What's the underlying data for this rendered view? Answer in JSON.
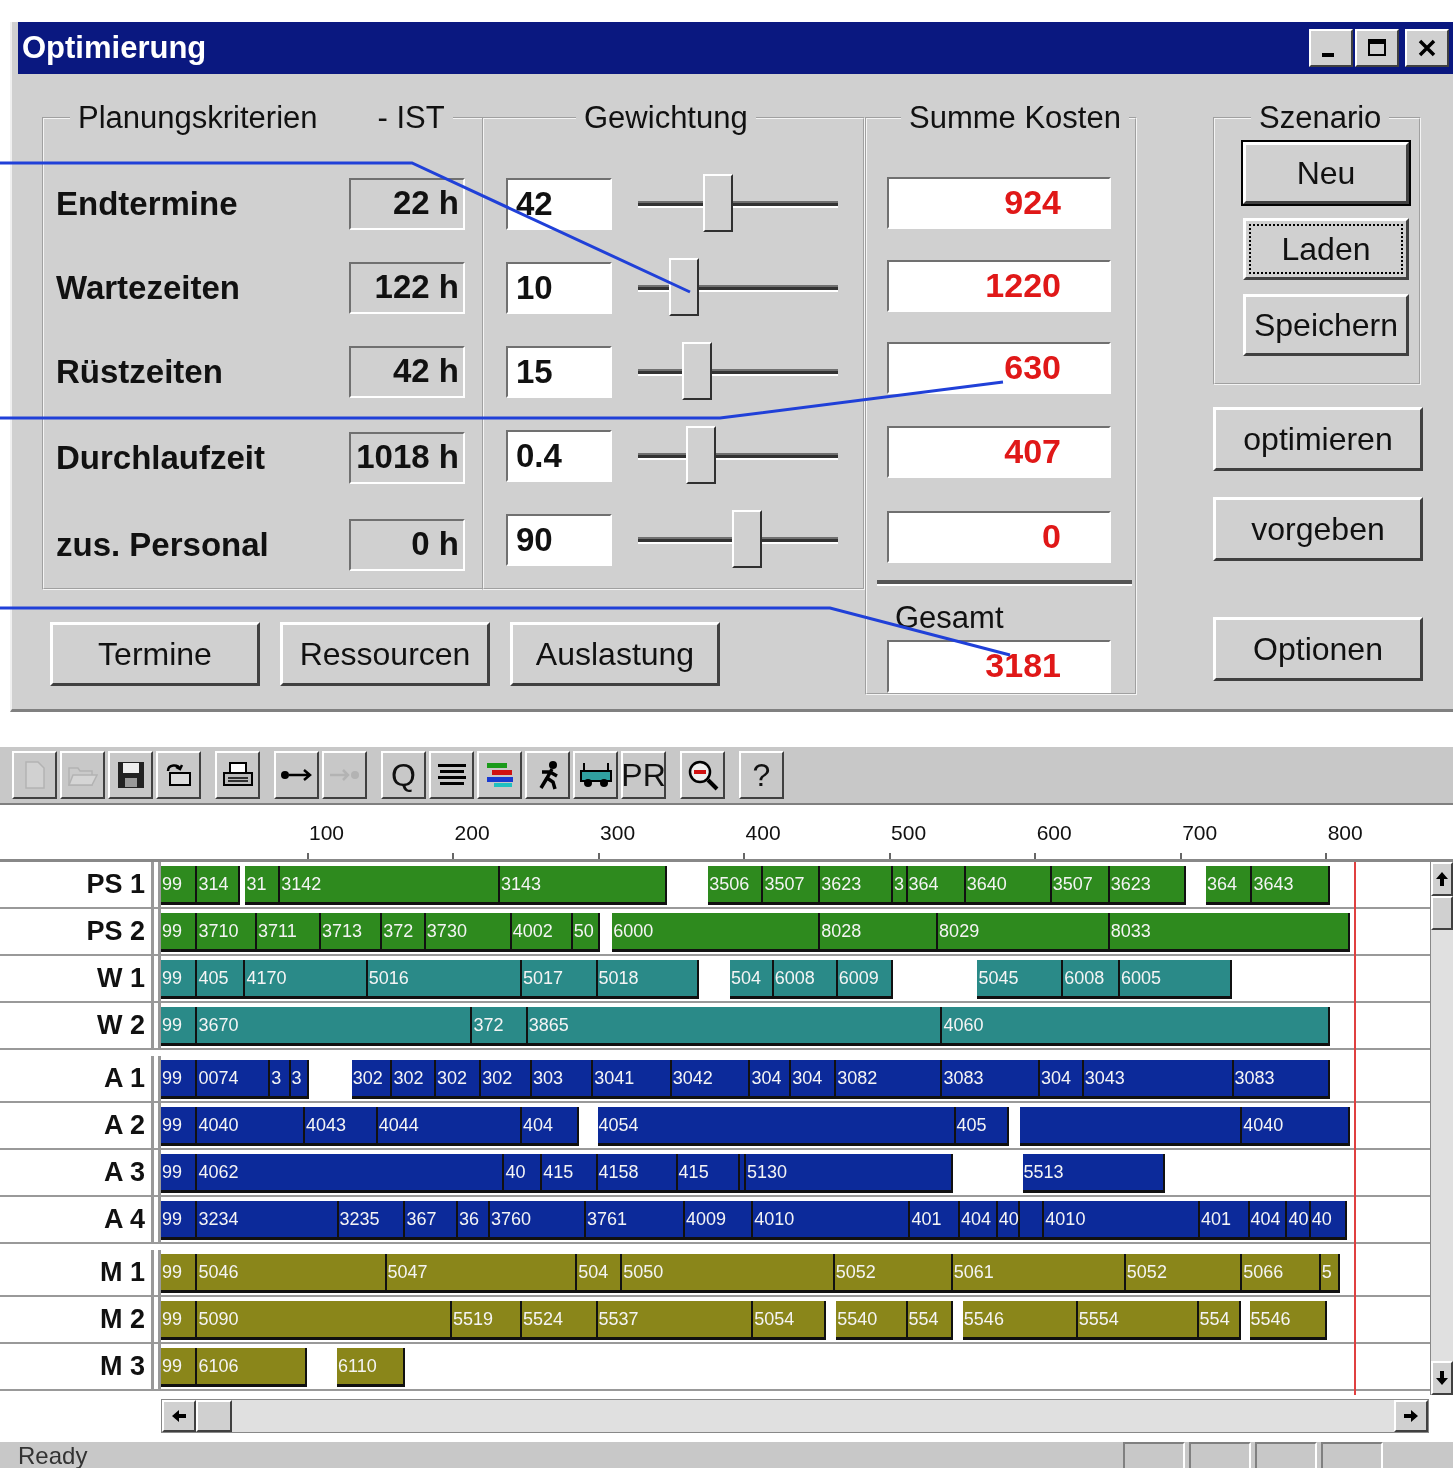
{
  "window": {
    "title": "Optimierung"
  },
  "legends": {
    "criteria": "Planungskriterien",
    "actual": "- IST",
    "weighting": "Gewichtung",
    "costs": "Summe Kosten"
  },
  "criteria": [
    {
      "label": "Endtermine",
      "actual": "22 h",
      "weight": "42",
      "level": 0.38,
      "cost": "924"
    },
    {
      "label": "Wartezeiten",
      "actual": "122 h",
      "weight": "10",
      "level": 0.18,
      "cost": "1220"
    },
    {
      "label": "Rüstzeiten",
      "actual": "42 h",
      "weight": "15",
      "level": 0.26,
      "cost": "630"
    },
    {
      "label": "Durchlaufzeit",
      "actual": "1018 h",
      "weight": "0.4",
      "level": 0.28,
      "cost": "407"
    },
    {
      "label": "zus. Personal",
      "actual": "0 h",
      "weight": "90",
      "level": 0.55,
      "cost": "0"
    }
  ],
  "total": {
    "label": "Gesamt",
    "value": "3181"
  },
  "view_buttons": [
    "Termine",
    "Ressourcen",
    "Auslastung"
  ],
  "scenario": {
    "legend": "Szenario",
    "buttons": [
      {
        "label": "Neu",
        "kind": "default"
      },
      {
        "label": "Laden",
        "kind": "focused"
      },
      {
        "label": "Speichern",
        "kind": "normal"
      }
    ]
  },
  "actions": [
    "optimieren",
    "vorgeben",
    "Optionen"
  ],
  "toolbar": [
    [
      {
        "kind": "new",
        "disabled": true
      },
      {
        "kind": "open",
        "disabled": true
      },
      {
        "kind": "save",
        "disabled": false
      },
      {
        "kind": "swap",
        "disabled": false
      }
    ],
    [
      {
        "kind": "print",
        "disabled": false
      }
    ],
    [
      {
        "kind": "dot-arrow",
        "disabled": false
      },
      {
        "kind": "arrow-dot",
        "disabled": true
      }
    ],
    [
      {
        "kind": "glyph",
        "glyph": "Q",
        "disabled": false
      },
      {
        "kind": "grid",
        "disabled": false
      },
      {
        "kind": "bars",
        "disabled": false
      },
      {
        "kind": "runner",
        "disabled": false
      },
      {
        "kind": "vehicle",
        "disabled": false
      },
      {
        "kind": "glyph",
        "glyph": "PR",
        "disabled": false
      }
    ],
    [
      {
        "kind": "zoom-out",
        "disabled": false
      }
    ],
    [
      {
        "kind": "glyph",
        "glyph": "?",
        "disabled": false
      }
    ]
  ],
  "gantt": {
    "ticks": [
      "100",
      "200",
      "300",
      "400",
      "500",
      "600",
      "700",
      "800"
    ],
    "groups": [
      {
        "rows": [
          {
            "label": "PS 1",
            "color": "#2e8a1e",
            "bars": [
              {
                "text": "99"
              },
              {
                "text": "314"
              },
              {
                "text": "31"
              },
              {
                "text": "3142"
              },
              {
                "text": "3143"
              },
              {
                "text": "3506"
              },
              {
                "text": "3507"
              },
              {
                "text": "3623"
              },
              {
                "text": "3"
              },
              {
                "text": "364"
              },
              {
                "text": "3640"
              },
              {
                "text": "3507"
              },
              {
                "text": "3623"
              },
              {
                "text": "364"
              },
              {
                "text": "3643"
              }
            ]
          },
          {
            "label": "PS 2",
            "color": "#2e8a1e",
            "bars": [
              {
                "text": "99"
              },
              {
                "text": "3710"
              },
              {
                "text": "3711"
              },
              {
                "text": "3713"
              },
              {
                "text": "372"
              },
              {
                "text": "3730"
              },
              {
                "text": "4002"
              },
              {
                "text": "50"
              },
              {
                "text": "6000"
              },
              {
                "text": "8028"
              },
              {
                "text": "8029"
              },
              {
                "text": "8033"
              }
            ]
          },
          {
            "label": "W 1",
            "color": "#2a8a88",
            "bars": [
              {
                "text": "99"
              },
              {
                "text": "405"
              },
              {
                "text": "4170"
              },
              {
                "text": "5016"
              },
              {
                "text": "5017"
              },
              {
                "text": "5018"
              },
              {
                "text": "504"
              },
              {
                "text": "6008"
              },
              {
                "text": "6009"
              },
              {
                "text": "5045"
              },
              {
                "text": "6008"
              },
              {
                "text": "6005"
              }
            ]
          },
          {
            "label": "W 2",
            "color": "#2a8a88",
            "bars": [
              {
                "text": "99"
              },
              {
                "text": "3670"
              },
              {
                "text": "372"
              },
              {
                "text": "3865"
              },
              {
                "text": "4060"
              }
            ]
          }
        ]
      },
      {
        "rows": [
          {
            "label": "A 1",
            "color": "#0c2a9a",
            "bars": [
              {
                "text": "99"
              },
              {
                "text": "0074"
              },
              {
                "text": "3"
              },
              {
                "text": "3"
              },
              {
                "text": "302"
              },
              {
                "text": "302"
              },
              {
                "text": "302"
              },
              {
                "text": "302"
              },
              {
                "text": "303"
              },
              {
                "text": "3041"
              },
              {
                "text": "3042"
              },
              {
                "text": "304"
              },
              {
                "text": "304"
              },
              {
                "text": "3082"
              },
              {
                "text": "3083"
              },
              {
                "text": "304"
              },
              {
                "text": "3043"
              },
              {
                "text": "3083"
              }
            ]
          },
          {
            "label": "A 2",
            "color": "#0c2a9a",
            "bars": [
              {
                "text": "99"
              },
              {
                "text": "4040"
              },
              {
                "text": "4043"
              },
              {
                "text": "4044"
              },
              {
                "text": "404"
              },
              {
                "text": "4054"
              },
              {
                "text": "405"
              },
              {
                "text": "4040"
              }
            ]
          },
          {
            "label": "A 3",
            "color": "#0c2a9a",
            "bars": [
              {
                "text": "99"
              },
              {
                "text": "4062"
              },
              {
                "text": "40"
              },
              {
                "text": "415"
              },
              {
                "text": "4158"
              },
              {
                "text": "415"
              },
              {
                "text": "5130"
              },
              {
                "text": "5513"
              }
            ]
          },
          {
            "label": "A 4",
            "color": "#0c2a9a",
            "bars": [
              {
                "text": "99"
              },
              {
                "text": "3234"
              },
              {
                "text": "3235"
              },
              {
                "text": "367"
              },
              {
                "text": "36"
              },
              {
                "text": "3760"
              },
              {
                "text": "3761"
              },
              {
                "text": "4009"
              },
              {
                "text": "4010"
              },
              {
                "text": "401"
              },
              {
                "text": "404"
              },
              {
                "text": "40"
              },
              {
                "text": "4010"
              },
              {
                "text": "401"
              },
              {
                "text": "404"
              },
              {
                "text": "40"
              },
              {
                "text": "40"
              }
            ]
          }
        ]
      },
      {
        "rows": [
          {
            "label": "M 1",
            "color": "#8a861a",
            "bars": [
              {
                "text": "99"
              },
              {
                "text": "5046"
              },
              {
                "text": "5047"
              },
              {
                "text": "504"
              },
              {
                "text": "5050"
              },
              {
                "text": "5052"
              },
              {
                "text": "5061"
              },
              {
                "text": "5052"
              },
              {
                "text": "5066"
              },
              {
                "text": "5"
              }
            ]
          },
          {
            "label": "M 2",
            "color": "#8a861a",
            "bars": [
              {
                "text": "99"
              },
              {
                "text": "5090"
              },
              {
                "text": "5519"
              },
              {
                "text": "5524"
              },
              {
                "text": "5537"
              },
              {
                "text": "5054"
              },
              {
                "text": "5540"
              },
              {
                "text": "554"
              },
              {
                "text": "5546"
              },
              {
                "text": "5554"
              },
              {
                "text": "554"
              },
              {
                "text": "5546"
              }
            ]
          },
          {
            "label": "M 3",
            "color": "#8a861a",
            "bars": [
              {
                "text": "99"
              },
              {
                "text": "6106"
              },
              {
                "text": "6110"
              }
            ]
          }
        ]
      }
    ]
  },
  "status_bar": {
    "text": "Ready"
  }
}
